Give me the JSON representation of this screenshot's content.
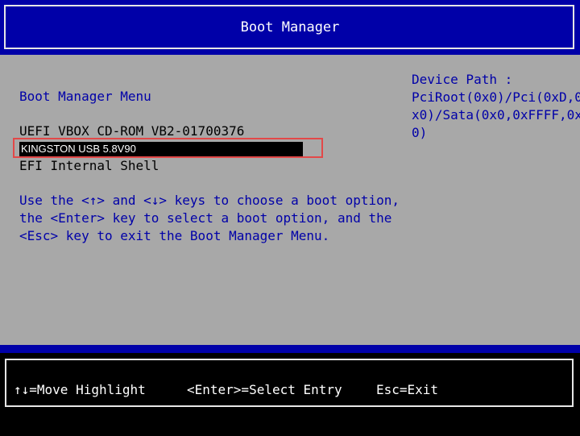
{
  "title": "Boot Manager",
  "menu_heading": "Boot Manager Menu",
  "device_path": {
    "label": "Device Path :",
    "lines": [
      "PciRoot(0x0)/Pci(0xD,0",
      "x0)/Sata(0x0,0xFFFF,0x",
      "0)"
    ]
  },
  "boot_options": [
    {
      "label": "UEFI VBOX CD-ROM VB2-01700376"
    },
    {
      "label": "KINGSTON USB 5.8V90"
    },
    {
      "label": "EFI Internal Shell"
    }
  ],
  "selected_index": 1,
  "help_lines": [
    "Use the <↑> and <↓> keys to choose a boot option,",
    "the <Enter> key to select a boot option, and the",
    "<Esc> key to exit the Boot Manager Menu."
  ],
  "footer": {
    "move": "↑↓=Move Highlight",
    "select": "<Enter>=Select Entry",
    "exit": "Esc=Exit"
  },
  "colors": {
    "bios_blue": "#0000a8",
    "panel_gray": "#a8a8a8",
    "highlight_bg": "#000000",
    "selection_outline": "#e34848"
  }
}
